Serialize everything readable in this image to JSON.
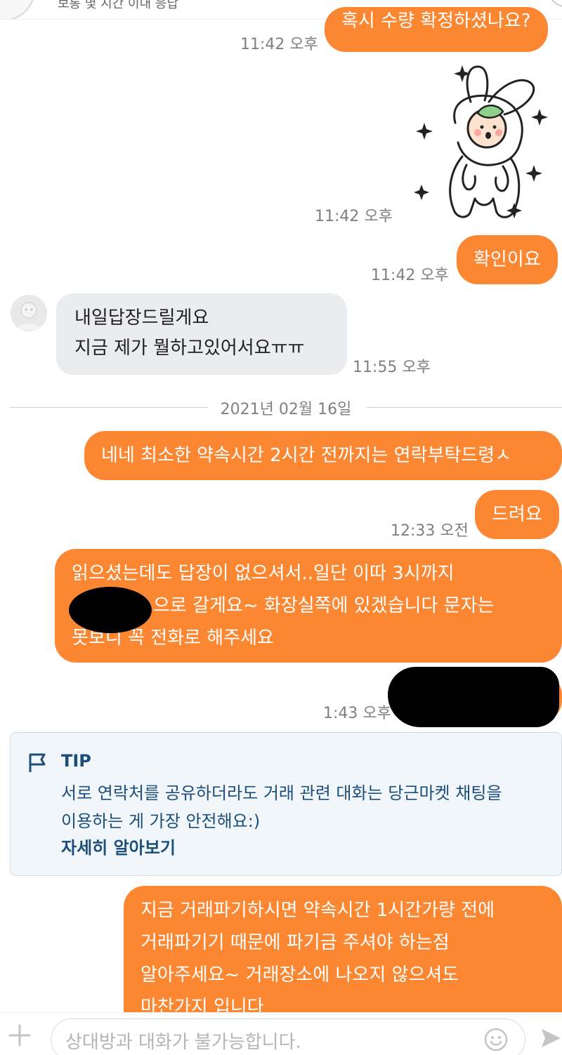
{
  "header": {
    "subtitle": "보통 몇 시간 이내 응답"
  },
  "messages": [
    {
      "text": "혹시 수량 확정하셨나요?",
      "time": "11:42 오후"
    },
    {
      "sticker": "bunny-costume-sticker",
      "time": "11:42 오후"
    },
    {
      "text": "확인이요",
      "time": "11:42 오후"
    },
    {
      "line1": "내일답장드릴게요",
      "line2": "지금 제가  뭘하고있어서요ㅠㅠ",
      "time": "11:55 오후"
    },
    {
      "text": "네네 최소한 약속시간 2시간 전까지는 연락부탁드령ㅅ"
    },
    {
      "text": "드려요",
      "time": "12:33 오전"
    },
    {
      "line1": "읽으셨는데도 답장이 없으셔서..일단 이따 3시까지",
      "line2": "으로 갈게요~ 화장실쪽에 있겠습니다 문자는",
      "line3": "못보니 꼭 전화로 해주세요"
    },
    {
      "time": "1:43 오후"
    },
    {
      "line1": "지금 거래파기하시면 약속시간 1시간가량 전에",
      "line2": "거래파기기 때문에 파기금 주셔야 하는점",
      "line3": "알아주세요~ 거래장소에 나오지 않으셔도",
      "line4": "마찬가지 입니다"
    }
  ],
  "date_separator": "2021년 02월 16일",
  "tip": {
    "title": "TIP",
    "text": "서로 연락처를 공유하더라도 거래 관련 대화는 당근마켓 채팅을 이용하는 게 가장 안전해요:)",
    "link": "자세히 알아보기"
  },
  "composer": {
    "placeholder": "상대방과 대화가 불가능합니다."
  },
  "colors": {
    "accent": "#fc8732",
    "their_bubble": "#eaecef",
    "tip_text": "#1d4e7a",
    "tip_bg": "#f1f6fa"
  }
}
